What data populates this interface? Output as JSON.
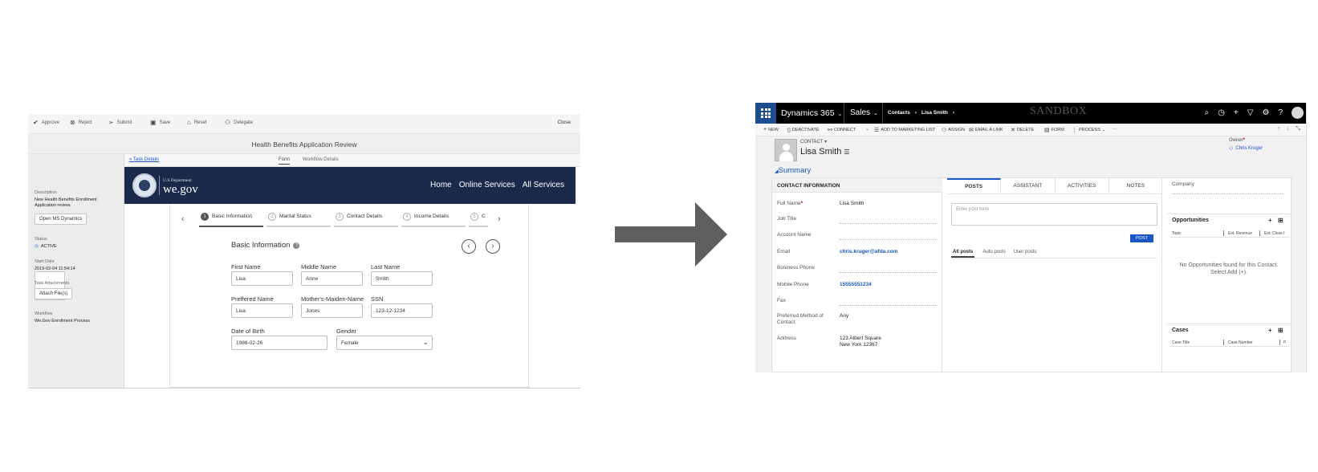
{
  "left_app": {
    "toolbar": {
      "approve": "Approve",
      "reject": "Reject",
      "submit": "Submit",
      "save": "Save",
      "reset": "Reset",
      "delegate": "Delegate",
      "close": "Close"
    },
    "title": "Health Benefits Application Review",
    "sidebar": {
      "description_label": "Description",
      "description_value": "New Health Benefits Enrollment Application review.",
      "open_button": "Open MS Dynamics",
      "status_label": "Status",
      "status_value": "ACTIVE",
      "start_label": "Start Date",
      "start_value": "2019-02-04 11:54:14",
      "attach_label": "Task Attachments",
      "attach_button": "Attach File(s)",
      "workflow_label": "Workflow",
      "workflow_value": "We.Gov Enrollment Process"
    },
    "subtabs": {
      "task_details": "Task Details",
      "form": "Form",
      "workflow": "Workflow Details"
    },
    "brand": {
      "small": "U.S Department",
      "big": "we.gov"
    },
    "nav": [
      "Home",
      "Online Services",
      "All Services"
    ],
    "steps": [
      {
        "num": "1",
        "label": "Basic Information"
      },
      {
        "num": "2",
        "label": "Marital Status"
      },
      {
        "num": "3",
        "label": "Contact Details"
      },
      {
        "num": "4",
        "label": "Income Details"
      },
      {
        "num": "5",
        "label": "C"
      }
    ],
    "section_title": "Basic Information",
    "fields": {
      "first_name": {
        "label": "First Name",
        "value": "Lisa"
      },
      "middle_name": {
        "label": "Middle Name",
        "value": "Anne"
      },
      "last_name": {
        "label": "Last Name",
        "value": "Smith"
      },
      "preferred_name": {
        "label": "Preffered Name",
        "value": "Lisa"
      },
      "maiden_name": {
        "label": "Mother's-Maiden-Name",
        "value": "Jones"
      },
      "ssn": {
        "label": "SSN",
        "value": "123-12-1234"
      },
      "dob": {
        "label": "Date of Birth",
        "value": "1986-02-26"
      },
      "gender": {
        "label": "Gender",
        "value": "Female"
      }
    }
  },
  "right_app": {
    "nav": {
      "app_name": "Dynamics 365",
      "area": "Sales",
      "breadcrumb": [
        "Contacts",
        "Lisa Smith"
      ],
      "watermark": "SANDBOX"
    },
    "commands": [
      "NEW",
      "DEACTIVATE",
      "CONNECT",
      "ADD TO MARKETING LIST",
      "ASSIGN",
      "EMAIL A LINK",
      "DELETE",
      "FORM",
      "PROCESS",
      "···"
    ],
    "entity_label": "CONTACT",
    "record_name": "Lisa Smith",
    "owner_label": "Owner",
    "owner_value": "Chris Kruger",
    "summary_label": "Summary",
    "contact_info": {
      "heading": "CONTACT INFORMATION",
      "rows": [
        {
          "label": "Full Name",
          "value": "Lisa Smith"
        },
        {
          "label": "Job Title",
          "value": ""
        },
        {
          "label": "Account Name",
          "value": ""
        },
        {
          "label": "Email",
          "value": "chris.kruger@afda.com"
        },
        {
          "label": "Business Phone",
          "value": ""
        },
        {
          "label": "Mobile Phone",
          "value": "15555551234"
        },
        {
          "label": "Fax",
          "value": ""
        },
        {
          "label": "Preferred Method of Contact",
          "value": "Any"
        },
        {
          "label": "Address",
          "value": "123 Albert Square",
          "value2": "New York 12367"
        }
      ]
    },
    "posts": {
      "tabs": [
        "POSTS",
        "ASSISTANT",
        "ACTIVITIES",
        "NOTES"
      ],
      "placeholder": "Enter post here",
      "post_button": "POST",
      "filters": [
        "All posts",
        "Auto posts",
        "User posts"
      ]
    },
    "side": {
      "company_label": "Company",
      "opportunities": {
        "title": "Opportunities",
        "columns": [
          "Topic",
          "Est. Revenue",
          "Est. Close I"
        ],
        "empty": "No Opportunities found for this Contact. Select Add (+)."
      },
      "cases": {
        "title": "Cases",
        "columns": [
          "Case Title",
          "Case Number",
          "P"
        ]
      }
    }
  }
}
